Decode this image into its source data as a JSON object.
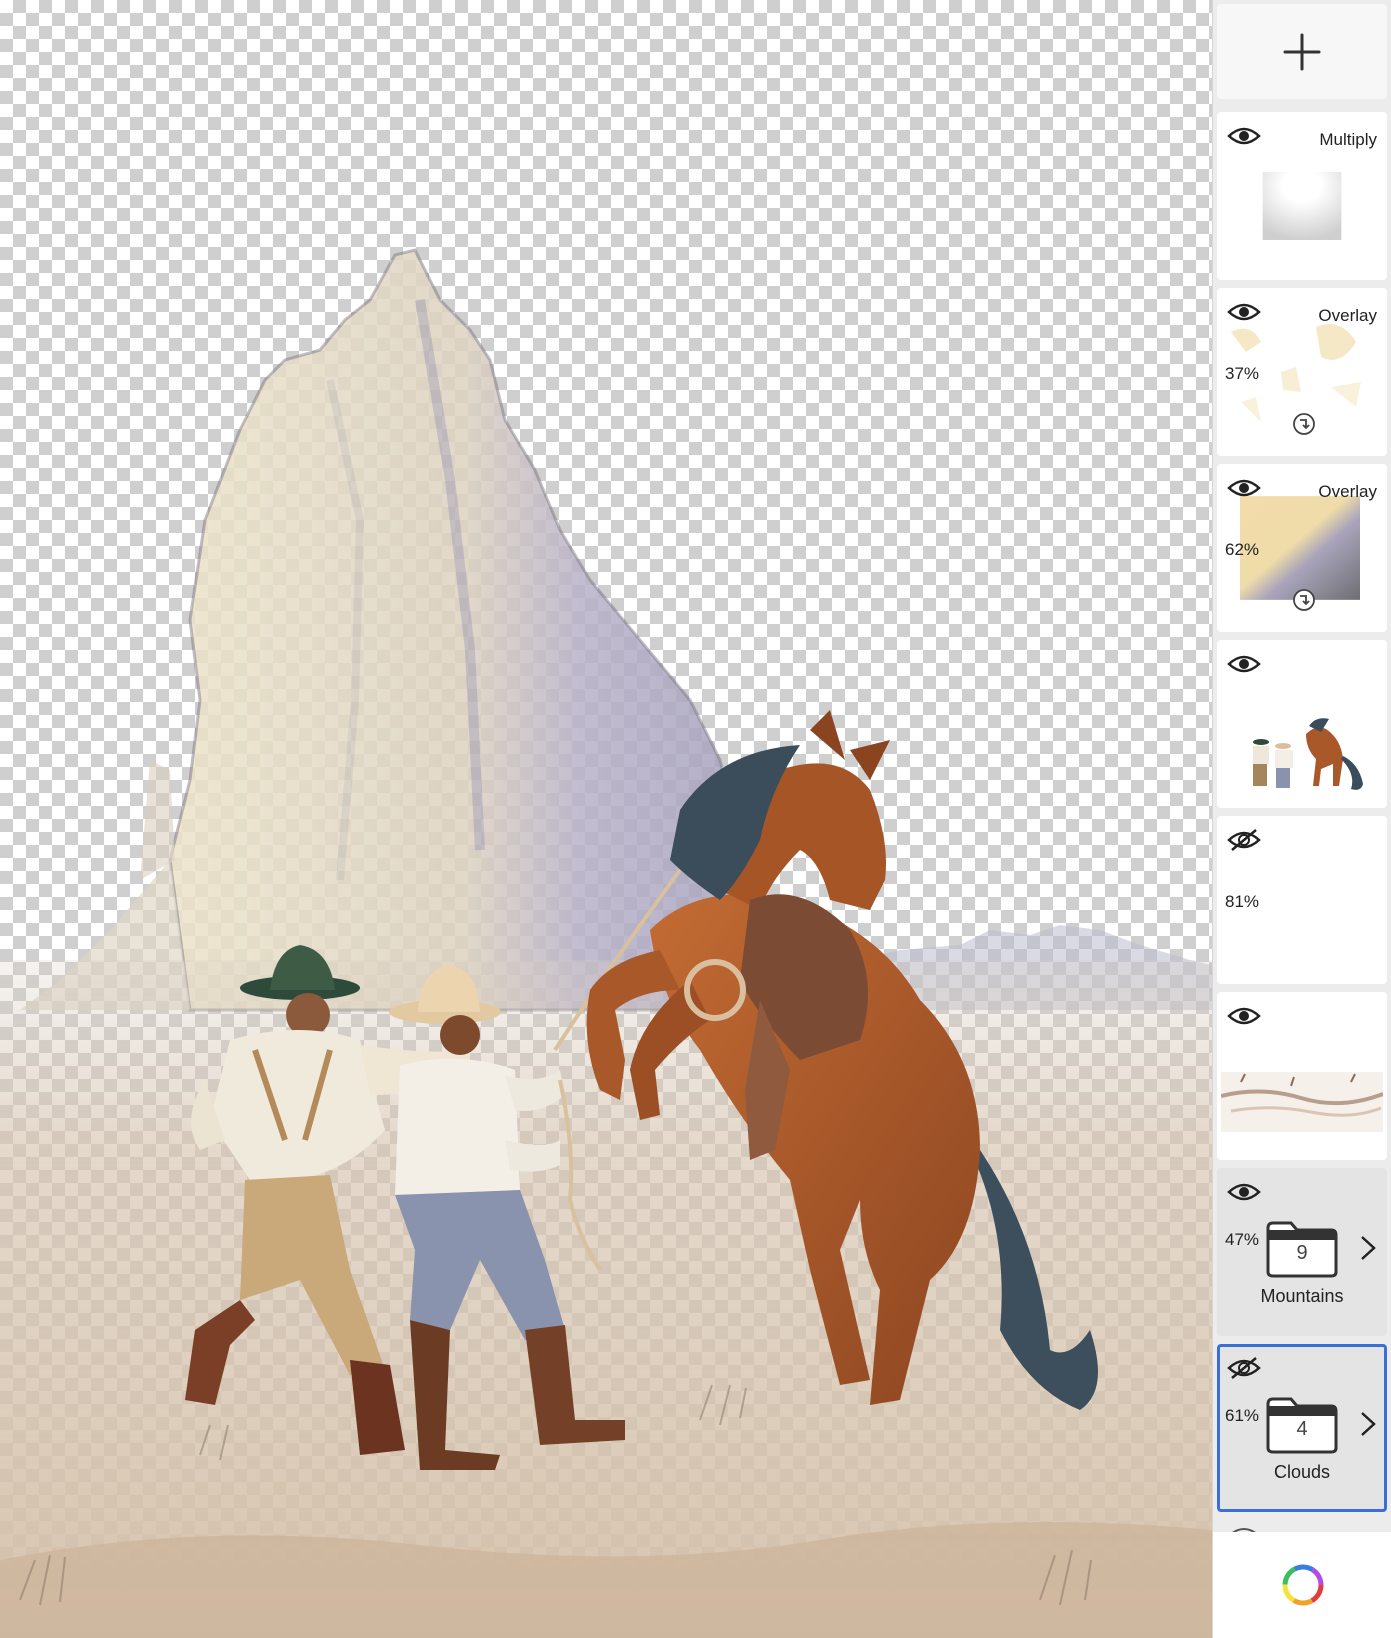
{
  "panel": {
    "add_layer_icon": "plus-icon",
    "color_picker_icon": "color-wheel-icon"
  },
  "layers": [
    {
      "id": "multiply-layer",
      "blend": "Multiply",
      "opacity": "",
      "visible": true,
      "thumbnail": "white-vignette"
    },
    {
      "id": "overlay-layer-1",
      "blend": "Overlay",
      "opacity": "37%",
      "visible": true,
      "clipped": true,
      "thumbnail": "cream-blots"
    },
    {
      "id": "overlay-layer-2",
      "blend": "Overlay",
      "opacity": "62%",
      "visible": true,
      "clipped": true,
      "thumbnail": "gradient"
    },
    {
      "id": "characters-layer",
      "blend": "",
      "opacity": "",
      "visible": true,
      "thumbnail": "cowboys-and-horse"
    },
    {
      "id": "hidden-layer",
      "blend": "",
      "opacity": "81%",
      "visible": false,
      "thumbnail": "blank"
    },
    {
      "id": "ground-layer",
      "blend": "",
      "opacity": "",
      "visible": true,
      "thumbnail": "ground-strip"
    }
  ],
  "groups": [
    {
      "id": "mountains-group",
      "name": "Mountains",
      "count": "9",
      "opacity": "47%",
      "visible": true,
      "selected": false
    },
    {
      "id": "clouds-group",
      "name": "Clouds",
      "count": "4",
      "opacity": "61%",
      "visible": false,
      "selected": true
    }
  ],
  "colors": {
    "selection": "#3a6fd8",
    "horse": "#a9582a",
    "mane": "#3b4c5a",
    "mesa_light": "#e6dcc0",
    "mesa_shadow": "#a9a2bd",
    "ground": "#dcccb9"
  }
}
